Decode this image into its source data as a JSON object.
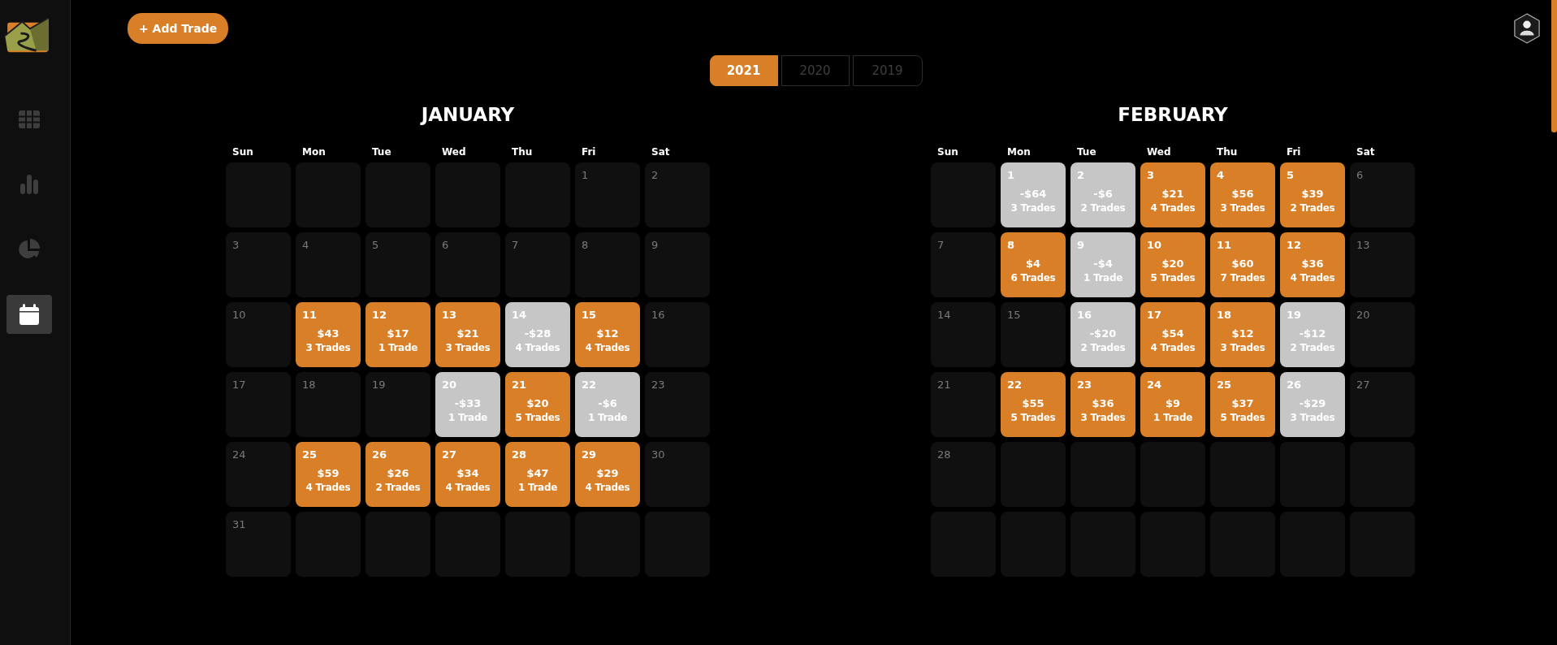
{
  "sidebar": {
    "items": [
      {
        "kind": "table",
        "selected": false
      },
      {
        "kind": "bars",
        "selected": false
      },
      {
        "kind": "pie",
        "selected": false
      },
      {
        "kind": "calendar",
        "selected": true
      }
    ]
  },
  "add_button": {
    "label": "+ Add Trade"
  },
  "year_tabs": [
    {
      "label": "2021",
      "selected": true
    },
    {
      "label": "2020",
      "selected": false
    },
    {
      "label": "2019",
      "selected": false
    }
  ],
  "months": [
    {
      "name": "JANUARY",
      "weekdays": [
        "Sun",
        "Mon",
        "Tue",
        "Wed",
        "Thu",
        "Fri",
        "Sat"
      ],
      "cells": [
        {
          "kind": "empty"
        },
        {
          "kind": "empty"
        },
        {
          "kind": "empty"
        },
        {
          "kind": "empty"
        },
        {
          "kind": "empty"
        },
        {
          "kind": "plain",
          "day": "1"
        },
        {
          "kind": "plain",
          "day": "2"
        },
        {
          "kind": "plain",
          "day": "3"
        },
        {
          "kind": "plain",
          "day": "4"
        },
        {
          "kind": "plain",
          "day": "5"
        },
        {
          "kind": "plain",
          "day": "6"
        },
        {
          "kind": "plain",
          "day": "7"
        },
        {
          "kind": "plain",
          "day": "8"
        },
        {
          "kind": "plain",
          "day": "9"
        },
        {
          "kind": "plain",
          "day": "10"
        },
        {
          "kind": "profit",
          "day": "11",
          "amount": "$43",
          "trades": "3 Trades"
        },
        {
          "kind": "profit",
          "day": "12",
          "amount": "$17",
          "trades": "1 Trade"
        },
        {
          "kind": "profit",
          "day": "13",
          "amount": "$21",
          "trades": "3 Trades"
        },
        {
          "kind": "loss",
          "day": "14",
          "amount": "-$28",
          "trades": "4 Trades"
        },
        {
          "kind": "profit",
          "day": "15",
          "amount": "$12",
          "trades": "4 Trades"
        },
        {
          "kind": "plain",
          "day": "16"
        },
        {
          "kind": "plain",
          "day": "17"
        },
        {
          "kind": "plain",
          "day": "18"
        },
        {
          "kind": "plain",
          "day": "19"
        },
        {
          "kind": "loss",
          "day": "20",
          "amount": "-$33",
          "trades": "1 Trade"
        },
        {
          "kind": "profit",
          "day": "21",
          "amount": "$20",
          "trades": "5 Trades"
        },
        {
          "kind": "loss",
          "day": "22",
          "amount": "-$6",
          "trades": "1 Trade"
        },
        {
          "kind": "plain",
          "day": "23"
        },
        {
          "kind": "plain",
          "day": "24"
        },
        {
          "kind": "profit",
          "day": "25",
          "amount": "$59",
          "trades": "4 Trades"
        },
        {
          "kind": "profit",
          "day": "26",
          "amount": "$26",
          "trades": "2 Trades"
        },
        {
          "kind": "profit",
          "day": "27",
          "amount": "$34",
          "trades": "4 Trades"
        },
        {
          "kind": "profit",
          "day": "28",
          "amount": "$47",
          "trades": "1 Trade"
        },
        {
          "kind": "profit",
          "day": "29",
          "amount": "$29",
          "trades": "4 Trades"
        },
        {
          "kind": "plain",
          "day": "30"
        },
        {
          "kind": "plain",
          "day": "31"
        },
        {
          "kind": "empty"
        },
        {
          "kind": "empty"
        },
        {
          "kind": "empty"
        },
        {
          "kind": "empty"
        },
        {
          "kind": "empty"
        },
        {
          "kind": "empty"
        }
      ]
    },
    {
      "name": "FEBRUARY",
      "weekdays": [
        "Sun",
        "Mon",
        "Tue",
        "Wed",
        "Thu",
        "Fri",
        "Sat"
      ],
      "cells": [
        {
          "kind": "empty"
        },
        {
          "kind": "loss",
          "day": "1",
          "amount": "-$64",
          "trades": "3 Trades"
        },
        {
          "kind": "loss",
          "day": "2",
          "amount": "-$6",
          "trades": "2 Trades"
        },
        {
          "kind": "profit",
          "day": "3",
          "amount": "$21",
          "trades": "4 Trades"
        },
        {
          "kind": "profit",
          "day": "4",
          "amount": "$56",
          "trades": "3 Trades"
        },
        {
          "kind": "profit",
          "day": "5",
          "amount": "$39",
          "trades": "2 Trades"
        },
        {
          "kind": "plain",
          "day": "6"
        },
        {
          "kind": "plain",
          "day": "7"
        },
        {
          "kind": "profit",
          "day": "8",
          "amount": "$4",
          "trades": "6 Trades"
        },
        {
          "kind": "loss",
          "day": "9",
          "amount": "-$4",
          "trades": "1 Trade"
        },
        {
          "kind": "profit",
          "day": "10",
          "amount": "$20",
          "trades": "5 Trades"
        },
        {
          "kind": "profit",
          "day": "11",
          "amount": "$60",
          "trades": "7 Trades"
        },
        {
          "kind": "profit",
          "day": "12",
          "amount": "$36",
          "trades": "4 Trades"
        },
        {
          "kind": "plain",
          "day": "13"
        },
        {
          "kind": "plain",
          "day": "14"
        },
        {
          "kind": "plain",
          "day": "15"
        },
        {
          "kind": "loss",
          "day": "16",
          "amount": "-$20",
          "trades": "2 Trades"
        },
        {
          "kind": "profit",
          "day": "17",
          "amount": "$54",
          "trades": "4 Trades"
        },
        {
          "kind": "profit",
          "day": "18",
          "amount": "$12",
          "trades": "3 Trades"
        },
        {
          "kind": "loss",
          "day": "19",
          "amount": "-$12",
          "trades": "2 Trades"
        },
        {
          "kind": "plain",
          "day": "20"
        },
        {
          "kind": "plain",
          "day": "21"
        },
        {
          "kind": "profit",
          "day": "22",
          "amount": "$55",
          "trades": "5 Trades"
        },
        {
          "kind": "profit",
          "day": "23",
          "amount": "$36",
          "trades": "3 Trades"
        },
        {
          "kind": "profit",
          "day": "24",
          "amount": "$9",
          "trades": "1 Trade"
        },
        {
          "kind": "profit",
          "day": "25",
          "amount": "$37",
          "trades": "5 Trades"
        },
        {
          "kind": "loss",
          "day": "26",
          "amount": "-$29",
          "trades": "3 Trades"
        },
        {
          "kind": "plain",
          "day": "27"
        },
        {
          "kind": "plain",
          "day": "28"
        },
        {
          "kind": "empty"
        },
        {
          "kind": "empty"
        },
        {
          "kind": "empty"
        },
        {
          "kind": "empty"
        },
        {
          "kind": "empty"
        },
        {
          "kind": "empty"
        },
        {
          "kind": "empty"
        },
        {
          "kind": "empty"
        },
        {
          "kind": "empty"
        },
        {
          "kind": "empty"
        },
        {
          "kind": "empty"
        },
        {
          "kind": "empty"
        },
        {
          "kind": "empty"
        }
      ]
    }
  ]
}
